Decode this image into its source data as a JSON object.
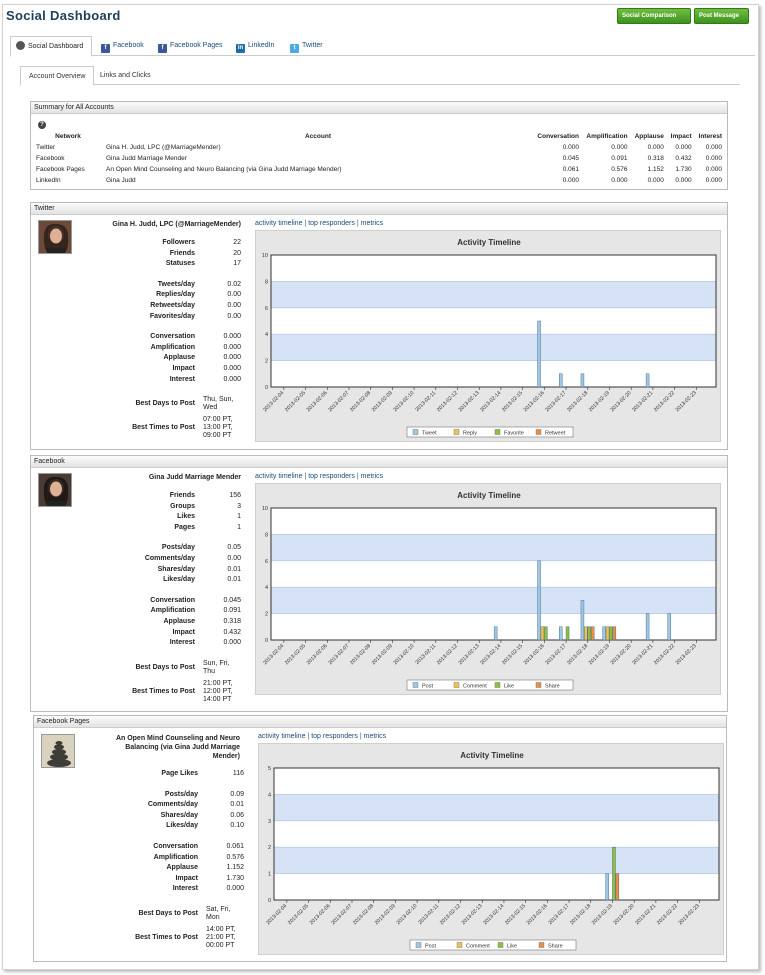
{
  "app": {
    "title": "Social Dashboard",
    "buttons": [
      "Social Comparison",
      "Post Message"
    ]
  },
  "tabs": [
    {
      "label": "Social Dashboard",
      "icon": "dashboard-icon"
    },
    {
      "label": "Facebook",
      "icon": "facebook-icon"
    },
    {
      "label": "Facebook Pages",
      "icon": "facebook-icon"
    },
    {
      "label": "LinkedIn",
      "icon": "linkedin-icon"
    },
    {
      "label": "Twitter",
      "icon": "twitter-icon"
    }
  ],
  "subtabs": [
    "Account Overview",
    "Links and Clicks"
  ],
  "summary": {
    "title": "Summary for All Accounts",
    "columns": [
      "Network",
      "Account",
      "Conversation",
      "Amplification",
      "Applause",
      "Impact",
      "Interest"
    ],
    "rows": [
      [
        "Twitter",
        "Gina H. Judd, LPC (@MarriageMender)",
        "0.000",
        "0.000",
        "0.000",
        "0.000",
        "0.000"
      ],
      [
        "Facebook",
        "Gina Judd Marriage Mender",
        "0.045",
        "0.091",
        "0.318",
        "0.432",
        "0.000"
      ],
      [
        "Facebook Pages",
        "An Open Mind Counseling and Neuro Balancing (via Gina Judd Marriage Mender)",
        "0.061",
        "0.576",
        "1.152",
        "1.730",
        "0.000"
      ],
      [
        "LinkedIn",
        "Gina Judd",
        "0.000",
        "0.000",
        "0.000",
        "0.000",
        "0.000"
      ]
    ]
  },
  "links": {
    "activity": "activity timeline",
    "sep": " | ",
    "responders": "top responders",
    "metrics": "metrics"
  },
  "sections": [
    {
      "heading": "Twitter",
      "account": "Gina H. Judd, LPC (@MarriageMender)",
      "groups": [
        [
          [
            "Followers",
            "22"
          ],
          [
            "Friends",
            "20"
          ],
          [
            "Statuses",
            "17"
          ]
        ],
        [
          [
            "Tweets/day",
            "0.02"
          ],
          [
            "Replies/day",
            "0.00"
          ],
          [
            "Retweets/day",
            "0.00"
          ],
          [
            "Favorites/day",
            "0.00"
          ]
        ],
        [
          [
            "Conversation",
            "0.000"
          ],
          [
            "Amplification",
            "0.000"
          ],
          [
            "Applause",
            "0.000"
          ],
          [
            "Impact",
            "0.000"
          ],
          [
            "Interest",
            "0.000"
          ]
        ]
      ],
      "best_days_label": "Best Days to Post",
      "best_days": [
        "Thu, Sun,",
        "Wed"
      ],
      "best_times_label": "Best Times to Post",
      "best_times": [
        "07:00 PT,",
        "13:00 PT,",
        "09:00 PT"
      ]
    },
    {
      "heading": "Facebook",
      "account": "Gina Judd Marriage Mender",
      "groups": [
        [
          [
            "Friends",
            "156"
          ],
          [
            "Groups",
            "3"
          ],
          [
            "Likes",
            "1"
          ],
          [
            "Pages",
            "1"
          ]
        ],
        [
          [
            "Posts/day",
            "0.05"
          ],
          [
            "Comments/day",
            "0.00"
          ],
          [
            "Shares/day",
            "0.01"
          ],
          [
            "Likes/day",
            "0.01"
          ]
        ],
        [
          [
            "Conversation",
            "0.045"
          ],
          [
            "Amplification",
            "0.091"
          ],
          [
            "Applause",
            "0.318"
          ],
          [
            "Impact",
            "0.432"
          ],
          [
            "Interest",
            "0.000"
          ]
        ]
      ],
      "best_days_label": "Best Days to Post",
      "best_days": [
        "Sun, Fri,",
        "Thu"
      ],
      "best_times_label": "Best Times to Post",
      "best_times": [
        "21:00 PT,",
        "12:00 PT,",
        "14:00 PT"
      ]
    },
    {
      "heading": "Facebook Pages",
      "account": "An Open Mind Counseling and Neuro Balancing (via Gina Judd Marriage Mender)",
      "account_lines": [
        "An Open Mind Counseling and Neuro",
        "Balancing (via Gina Judd Marriage",
        "Mender)"
      ],
      "groups": [
        [
          [
            "Page Likes",
            "116"
          ]
        ],
        [
          [
            "Posts/day",
            "0.09"
          ],
          [
            "Comments/day",
            "0.01"
          ],
          [
            "Shares/day",
            "0.06"
          ],
          [
            "Likes/day",
            "0.10"
          ]
        ],
        [
          [
            "Conversation",
            "0.061"
          ],
          [
            "Amplification",
            "0.576"
          ],
          [
            "Applause",
            "1.152"
          ],
          [
            "Impact",
            "1.730"
          ],
          [
            "Interest",
            "0.000"
          ]
        ]
      ],
      "best_days_label": "Best Days to Post",
      "best_days": [
        "Sat, Fri,",
        "Mon"
      ],
      "best_times_label": "Best Times to Post",
      "best_times": [
        "14:00 PT,",
        "21:00 PT,",
        "00:00 PT"
      ]
    }
  ],
  "chart_data": [
    {
      "type": "bar",
      "title": "Activity Timeline",
      "categories": [
        "2013-02-04",
        "2013-02-05",
        "2013-02-06",
        "2013-02-07",
        "2013-02-08",
        "2013-02-09",
        "2013-02-10",
        "2013-02-11",
        "2013-02-12",
        "2013-02-13",
        "2013-02-14",
        "2013-02-15",
        "2013-02-16",
        "2013-02-17",
        "2013-02-18",
        "2013-02-19",
        "2013-02-20",
        "2013-02-21",
        "2013-02-22",
        "2013-02-23"
      ],
      "ylim": [
        0,
        10
      ],
      "yticks": [
        0,
        2,
        4,
        6,
        8,
        10
      ],
      "series": [
        {
          "name": "Tweet",
          "color": "#9ec7e6",
          "values": [
            0,
            0,
            0,
            0,
            0,
            0,
            0,
            0,
            0,
            0,
            0,
            0,
            5,
            1,
            1,
            0,
            0,
            1,
            0,
            0
          ]
        },
        {
          "name": "Reply",
          "color": "#f2c14e",
          "values": [
            0,
            0,
            0,
            0,
            0,
            0,
            0,
            0,
            0,
            0,
            0,
            0,
            0,
            0,
            0,
            0,
            0,
            0,
            0,
            0
          ]
        },
        {
          "name": "Favorite",
          "color": "#8fbf3f",
          "values": [
            0,
            0,
            0,
            0,
            0,
            0,
            0,
            0,
            0,
            0,
            0,
            0,
            0,
            0,
            0,
            0,
            0,
            0,
            0,
            0
          ]
        },
        {
          "name": "Retweet",
          "color": "#e8904a",
          "values": [
            0,
            0,
            0,
            0,
            0,
            0,
            0,
            0,
            0,
            0,
            0,
            0,
            0,
            0,
            0,
            0,
            0,
            0,
            0,
            0
          ]
        }
      ],
      "legend": "bottom",
      "grid": true
    },
    {
      "type": "bar",
      "title": "Activity Timeline",
      "categories": [
        "2013-02-04",
        "2013-02-05",
        "2013-02-06",
        "2013-02-07",
        "2013-02-08",
        "2013-02-09",
        "2013-02-10",
        "2013-02-11",
        "2013-02-12",
        "2013-02-13",
        "2013-02-14",
        "2013-02-15",
        "2013-02-16",
        "2013-02-17",
        "2013-02-18",
        "2013-02-19",
        "2013-02-20",
        "2013-02-21",
        "2013-02-22",
        "2013-02-23"
      ],
      "ylim": [
        0,
        10
      ],
      "yticks": [
        0,
        2,
        4,
        6,
        8,
        10
      ],
      "series": [
        {
          "name": "Post",
          "color": "#9ec7e6",
          "values": [
            0,
            0,
            0,
            0,
            0,
            0,
            0,
            0,
            0,
            0,
            1,
            0,
            6,
            1,
            3,
            1,
            0,
            2,
            2,
            0
          ]
        },
        {
          "name": "Comment",
          "color": "#f2c14e",
          "values": [
            0,
            0,
            0,
            0,
            0,
            0,
            0,
            0,
            0,
            0,
            0,
            0,
            1,
            0,
            1,
            1,
            0,
            0,
            0,
            0
          ]
        },
        {
          "name": "Like",
          "color": "#8fbf3f",
          "values": [
            0,
            0,
            0,
            0,
            0,
            0,
            0,
            0,
            0,
            0,
            0,
            0,
            1,
            1,
            1,
            1,
            0,
            0,
            0,
            0
          ]
        },
        {
          "name": "Share",
          "color": "#e8904a",
          "values": [
            0,
            0,
            0,
            0,
            0,
            0,
            0,
            0,
            0,
            0,
            0,
            0,
            0,
            0,
            1,
            1,
            0,
            0,
            0,
            0
          ]
        }
      ],
      "legend": "bottom",
      "grid": true
    },
    {
      "type": "bar",
      "title": "Activity Timeline",
      "categories": [
        "2013-02-04",
        "2013-02-05",
        "2013-02-06",
        "2013-02-07",
        "2013-02-08",
        "2013-02-09",
        "2013-02-10",
        "2013-02-11",
        "2013-02-12",
        "2013-02-13",
        "2013-02-14",
        "2013-02-15",
        "2013-02-16",
        "2013-02-17",
        "2013-02-18",
        "2013-02-19",
        "2013-02-20",
        "2013-02-21",
        "2013-02-22",
        "2013-02-23"
      ],
      "ylim": [
        0,
        5
      ],
      "yticks": [
        0,
        1,
        2,
        3,
        4,
        5
      ],
      "series": [
        {
          "name": "Post",
          "color": "#9ec7e6",
          "values": [
            0,
            0,
            0,
            0,
            0,
            0,
            0,
            0,
            0,
            0,
            0,
            0,
            0,
            0,
            0,
            1,
            0,
            0,
            0,
            0
          ]
        },
        {
          "name": "Comment",
          "color": "#f2c14e",
          "values": [
            0,
            0,
            0,
            0,
            0,
            0,
            0,
            0,
            0,
            0,
            0,
            0,
            0,
            0,
            0,
            0,
            0,
            0,
            0,
            0
          ]
        },
        {
          "name": "Like",
          "color": "#8fbf3f",
          "values": [
            0,
            0,
            0,
            0,
            0,
            0,
            0,
            0,
            0,
            0,
            0,
            0,
            0,
            0,
            0,
            2,
            0,
            0,
            0,
            0
          ]
        },
        {
          "name": "Share",
          "color": "#e8904a",
          "values": [
            0,
            0,
            0,
            0,
            0,
            0,
            0,
            0,
            0,
            0,
            0,
            0,
            0,
            0,
            0,
            1,
            0,
            0,
            0,
            0
          ]
        }
      ],
      "legend": "bottom",
      "grid": true
    }
  ]
}
